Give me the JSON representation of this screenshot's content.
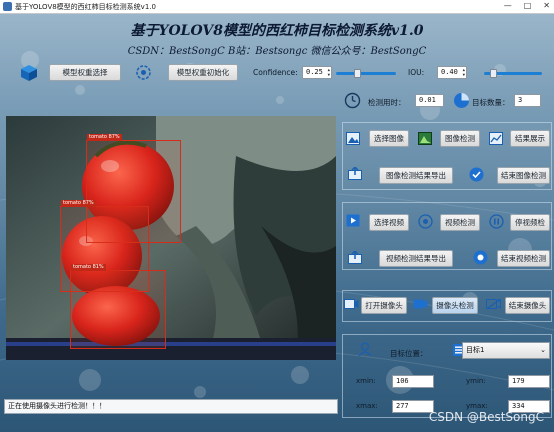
{
  "window": {
    "title": "基于YOLOV8模型的西红柿目标检测系统v1.0"
  },
  "header": {
    "title": "基于YOLOV8模型的西红柿目标检测系统v1.0",
    "subtitle": "CSDN：BestSongC   B站：Bestsongc   微信公众号：BestSongC"
  },
  "toolbar": {
    "model_select_label": "模型权重选择",
    "model_init_label": "模型权重初始化",
    "confidence_label": "Confidence:",
    "confidence_value": "0.25",
    "confidence_level": 0.25,
    "iou_label": "IOU:",
    "iou_value": "0.40",
    "iou_level": 0.4
  },
  "stats": {
    "time_label": "检测用时：",
    "time_value": "0.01",
    "count_label": "目标数量：",
    "count_value": "3"
  },
  "image_section": {
    "select_image": "选择图像",
    "detect_image": "图像检测",
    "show_result": "结果展示",
    "export_image_result": "图像检测结果导出",
    "end_image_detect": "结束图像检测"
  },
  "video_section": {
    "select_video": "选择视频",
    "detect_video": "视频检测",
    "pause_video": "停视频检",
    "export_video_result": "视频检测结果导出",
    "end_video_detect": "结束视频检测"
  },
  "camera_section": {
    "open_camera": "打开摄像头",
    "camera_detect": "摄像头检测",
    "close_camera": "结束摄像头"
  },
  "target_section": {
    "target_position_label": "目标位置：",
    "target_select": "目标1",
    "xmin_label": "xmin:",
    "xmin_value": "106",
    "ymin_label": "ymin:",
    "ymin_value": "179",
    "xmax_label": "xmax:",
    "xmax_value": "277",
    "ymax_label": "ymax:",
    "ymax_value": "334"
  },
  "detections": [
    {
      "label": "tomato  87%"
    },
    {
      "label": "tomato  87%"
    },
    {
      "label": "tomato  81%"
    }
  ],
  "status": {
    "message": "正在使用摄像头进行检测！！！"
  },
  "watermark": {
    "text": "CSDN @BestSongC"
  },
  "colors": {
    "accent": "#1d7fd4",
    "bbox": "#d62c1a"
  }
}
